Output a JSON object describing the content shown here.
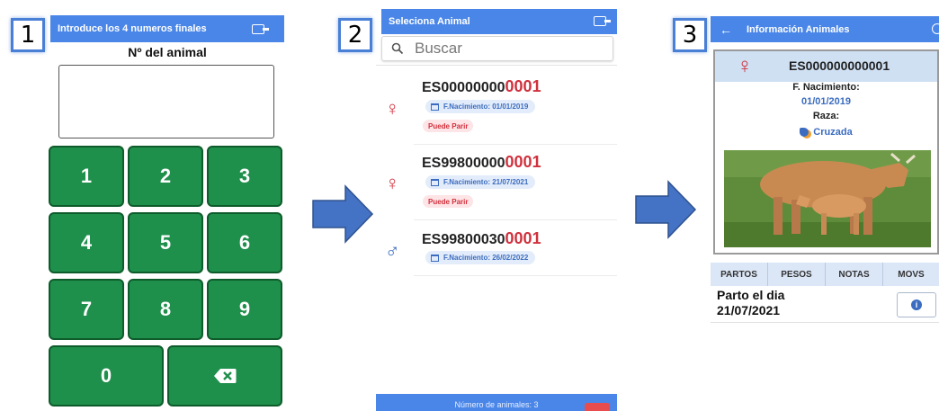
{
  "steps": [
    "1",
    "2",
    "3"
  ],
  "screen1": {
    "header": "Introduce los 4 numeros finales",
    "title": "Nº del animal",
    "input_value": "",
    "keys": [
      "1",
      "2",
      "3",
      "4",
      "5",
      "6",
      "7",
      "8",
      "9",
      "0"
    ],
    "exit_icon": "exit-icon",
    "backspace_icon": "backspace-icon"
  },
  "screen2": {
    "header": "Seleciona Animal",
    "search_placeholder": "Buscar",
    "animals": [
      {
        "prefix": "ES00000000",
        "suffix": "0001",
        "sex": "female",
        "birth": "F.Nacimiento: 01/01/2019",
        "badge": "Puede Parir"
      },
      {
        "prefix": "ES99800000",
        "suffix": "0001",
        "sex": "female",
        "birth": "F.Nacimiento: 21/07/2021",
        "badge": "Puede Parir"
      },
      {
        "prefix": "ES99800030",
        "suffix": "0001",
        "sex": "male",
        "birth": "F.Nacimiento: 26/02/2022",
        "badge": ""
      }
    ],
    "footer": "Número de animales: 3"
  },
  "screen3": {
    "header": "Información Animales",
    "animal_id": "ES000000000001",
    "birth_label": "F. Nacimiento:",
    "birth_value": "01/01/2019",
    "breed_label": "Raza:",
    "breed_value": "Cruzada",
    "tabs": [
      "PARTOS",
      "PESOS",
      "NOTAS",
      "MOVS"
    ],
    "event_title": "Parto el dia",
    "event_date": "21/07/2021"
  },
  "colors": {
    "header_blue": "#4a86e8",
    "key_green": "#1f8f4c",
    "female_red": "#d0313d",
    "male_blue": "#3b6cc0"
  }
}
